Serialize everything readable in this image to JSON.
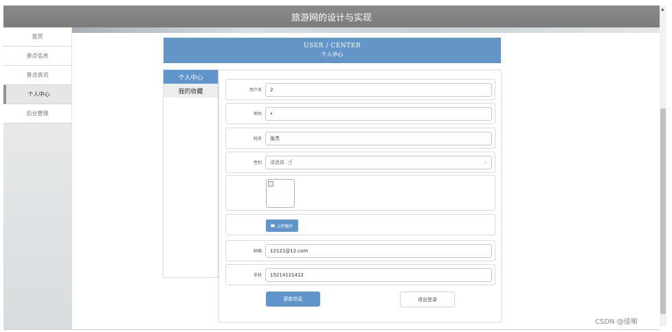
{
  "app": {
    "title": "旅游网的设计与实现"
  },
  "sidebar": {
    "items": [
      {
        "label": "首页"
      },
      {
        "label": "景点信息"
      },
      {
        "label": "景点资讯"
      },
      {
        "label": "个人中心"
      },
      {
        "label": "后台管理"
      }
    ],
    "active_index": 3
  },
  "user_center": {
    "en_title": "USER / CENTER",
    "cn_title": "个人中心"
  },
  "tabs": [
    {
      "label": "个人中心"
    },
    {
      "label": "我的收藏"
    }
  ],
  "form": {
    "username": {
      "label": "用户名",
      "value": "2"
    },
    "password": {
      "label": "密码",
      "value": "•"
    },
    "name": {
      "label": "姓名",
      "value": "张杰"
    },
    "gender": {
      "label": "性别",
      "placeholder": "请选择"
    },
    "upload_label": "上传图片",
    "email": {
      "label": "邮箱",
      "value": "12121@12.com"
    },
    "phone": {
      "label": "手机",
      "value": "15214121412"
    },
    "update_label": "更新信息",
    "logout_label": "退出登录"
  },
  "watermark": "CSDN @佳喻",
  "colors": {
    "primary": "#5f95cb",
    "header": "#858585"
  },
  "icons": {
    "cursor": "hand-pointer-icon",
    "upload": "cloud-upload-icon",
    "dropdown": "chevron-down-icon"
  }
}
